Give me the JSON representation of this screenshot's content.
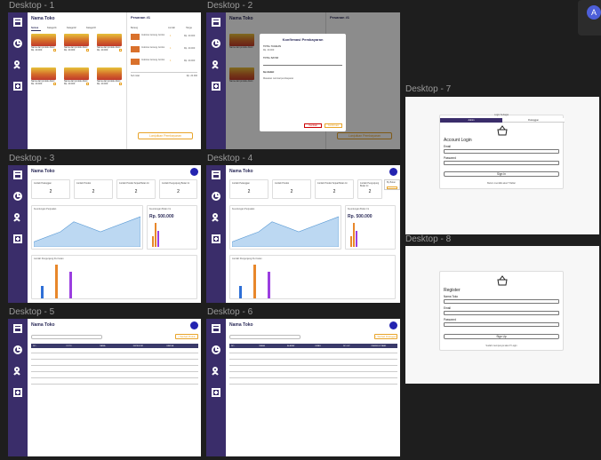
{
  "frames": {
    "d1": {
      "label": "Desktop - 1"
    },
    "d2": {
      "label": "Desktop - 2"
    },
    "d3": {
      "label": "Desktop - 3"
    },
    "d4": {
      "label": "Desktop - 4"
    },
    "d5": {
      "label": "Desktop - 5"
    },
    "d6": {
      "label": "Desktop - 6"
    },
    "d7": {
      "label": "Desktop - 7"
    },
    "d8": {
      "label": "Desktop - 8"
    }
  },
  "shop_name": "Nama Toko",
  "order": {
    "title": "Pesanan #1",
    "cols": [
      "Barang",
      "Jumlah",
      "Harga"
    ],
    "item_name": "Indomie Goreng Jumbo",
    "qty": "1",
    "price": "Rp. 20.000",
    "subtotal_label": "Sub total",
    "subtotal_value": "Rp. 20.000",
    "button": "Lanjutkan Pembayaran"
  },
  "categories": [
    "Semua",
    "Kategori1",
    "Kategori2",
    "Kategori3"
  ],
  "product": {
    "name": "Nama dari produk disini",
    "price": "Rp. 20.000"
  },
  "payment_modal": {
    "title": "Konfirmasi Pembayaran",
    "total_tagihan": "TOTAL TAGIHAN",
    "total_bayar": "TOTAL BAYAR",
    "kembalian": "Kembalian",
    "note": "Masukan nominal pembayaran",
    "cancel": "Kembali",
    "ok": "Konfirmasi"
  },
  "dashboard": {
    "cards": [
      {
        "label": "Jumlah Pelanggan",
        "value": "2"
      },
      {
        "label": "Jumlah Produk",
        "value": "2"
      },
      {
        "label": "Jumlah Produk Terjual Bulan Ini",
        "value": "2"
      },
      {
        "label": "Jumlah Pengunjung Bulan Ini",
        "value": "2"
      }
    ],
    "panel_sales": "Keuntungan Penjualan",
    "panel_income": "Keuntungan Bulan Ini",
    "income_value": "Rp. 500.000",
    "panel_visitors": "Jumlah Pengunjung Per bulan",
    "filter": "By Bulan"
  },
  "table5": {
    "search": "Cari",
    "add": "+ Tambah Produk",
    "cols": [
      "NO",
      "FOTO",
      "NAMA",
      "KATEGORI",
      "HARGA"
    ]
  },
  "table6": {
    "search": "Cari",
    "add": "+ Tambah Pelanggan",
    "cols": [
      "NO",
      "NAMA",
      "ALAMAT",
      "EMAIL",
      "NO. HP",
      "KEANGGOTAAN"
    ]
  },
  "login": {
    "top": "Login Sebagai",
    "tab_admin": "Admin",
    "tab_kasir": "Pelanggan",
    "title": "Account Login",
    "email": "Email",
    "password": "Password",
    "submit": "Sign In",
    "footer": "Belum memiliki akun? Daftar"
  },
  "register": {
    "title": "Register",
    "name": "Nama Toko",
    "email": "Email",
    "password": "Password",
    "submit": "Sign Up",
    "footer": "Sudah mempunyai akun? Login"
  },
  "colors": {
    "sidebar": "#3a2d6a",
    "accent": "#e8a42a",
    "chart_line": "#5b9bd5"
  },
  "line_chart": {
    "type": "area",
    "y": [
      1,
      2,
      3,
      5,
      4,
      3,
      4,
      5,
      6
    ]
  },
  "income_bars": {
    "type": "bar",
    "values": [
      0.4,
      0.9,
      0.6
    ]
  },
  "visitor_bars": {
    "type": "bar",
    "values": [
      0.35,
      0.95,
      0.75
    ]
  }
}
